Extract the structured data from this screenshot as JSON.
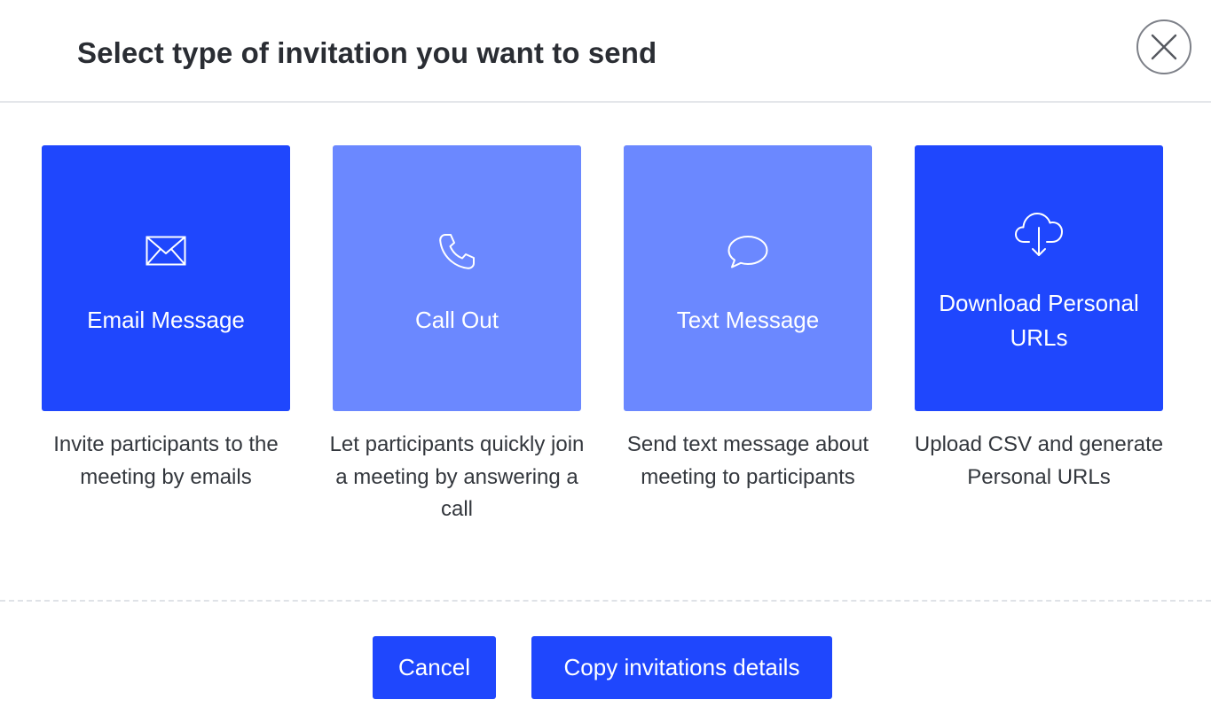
{
  "dialog": {
    "title": "Select type of invitation you want to send",
    "close_icon": "close-circle-icon"
  },
  "options": [
    {
      "label": "Email Message",
      "description": "Invite participants to the meeting by emails",
      "icon": "envelope-icon",
      "state": "selected"
    },
    {
      "label": "Call Out",
      "description": "Let participants quickly join a meeting by answering a call",
      "icon": "phone-icon",
      "state": "unselected"
    },
    {
      "label": "Text Message",
      "description": "Send text message about meeting to participants",
      "icon": "chat-bubble-icon",
      "state": "unselected"
    },
    {
      "label": "Download Personal URLs",
      "description": "Upload CSV and generate Personal URLs",
      "icon": "cloud-download-icon",
      "state": "selected"
    }
  ],
  "footer": {
    "cancel_label": "Cancel",
    "copy_label": "Copy invitations details"
  },
  "colors": {
    "primary": "#1f47fd",
    "primary_light": "#6b88ff",
    "title_text": "#2a2d33",
    "body_text": "#33373d",
    "divider": "#e4e6ea"
  }
}
